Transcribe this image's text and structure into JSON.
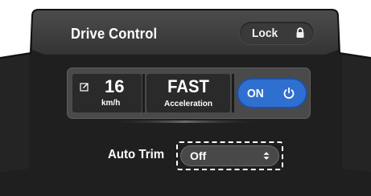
{
  "header": {
    "title": "Drive Control",
    "lock_label": "Lock",
    "lock_icon": "padlock-icon"
  },
  "readouts": {
    "speed_value": "16",
    "speed_unit": "km/h",
    "speed_icon": "edit-icon",
    "accel_value": "FAST",
    "accel_label": "Acceleration",
    "power_label": "ON",
    "power_icon": "power-icon"
  },
  "auto_trim": {
    "label": "Auto Trim",
    "selected": "Off",
    "chevron_icon": "up-down-chevron-icon"
  },
  "colors": {
    "panel": "#1e1e1e",
    "accent_blue": "#2f6fd0",
    "text": "#ffffff"
  }
}
